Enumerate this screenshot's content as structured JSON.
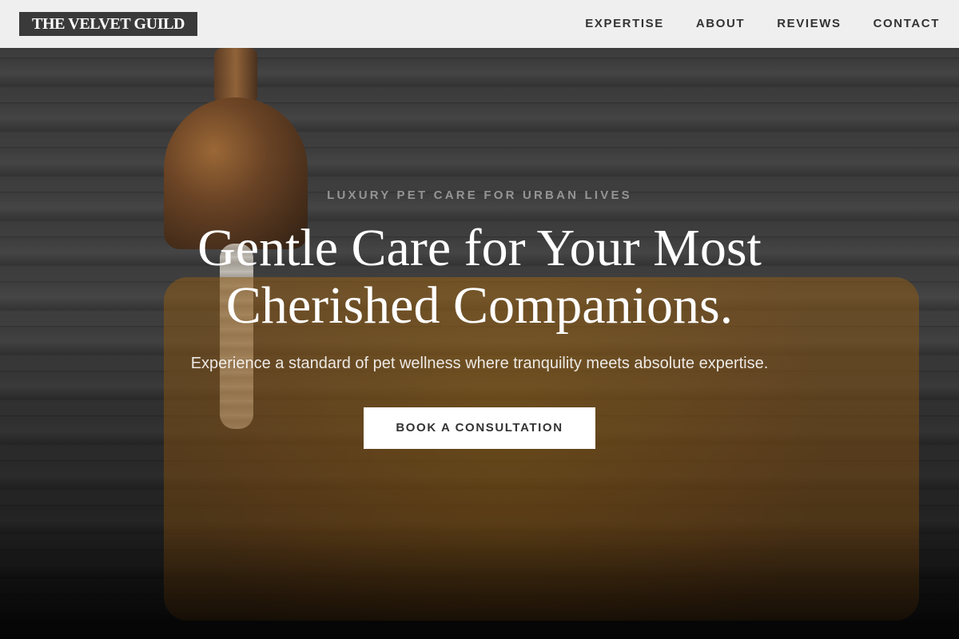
{
  "header": {
    "logo": "THE VELVET GUILD",
    "nav": [
      {
        "label": "EXPERTISE"
      },
      {
        "label": "ABOUT"
      },
      {
        "label": "REVIEWS"
      },
      {
        "label": "CONTACT"
      }
    ]
  },
  "hero": {
    "eyebrow": "LUXURY PET CARE FOR URBAN LIVES",
    "title_line_1": "Gentle Care for Your Most",
    "title_line_2": "Cherished Companions.",
    "subtitle": "Experience a standard of pet wellness where tranquility meets absolute expertise.",
    "cta_label": "BOOK A CONSULTATION"
  }
}
